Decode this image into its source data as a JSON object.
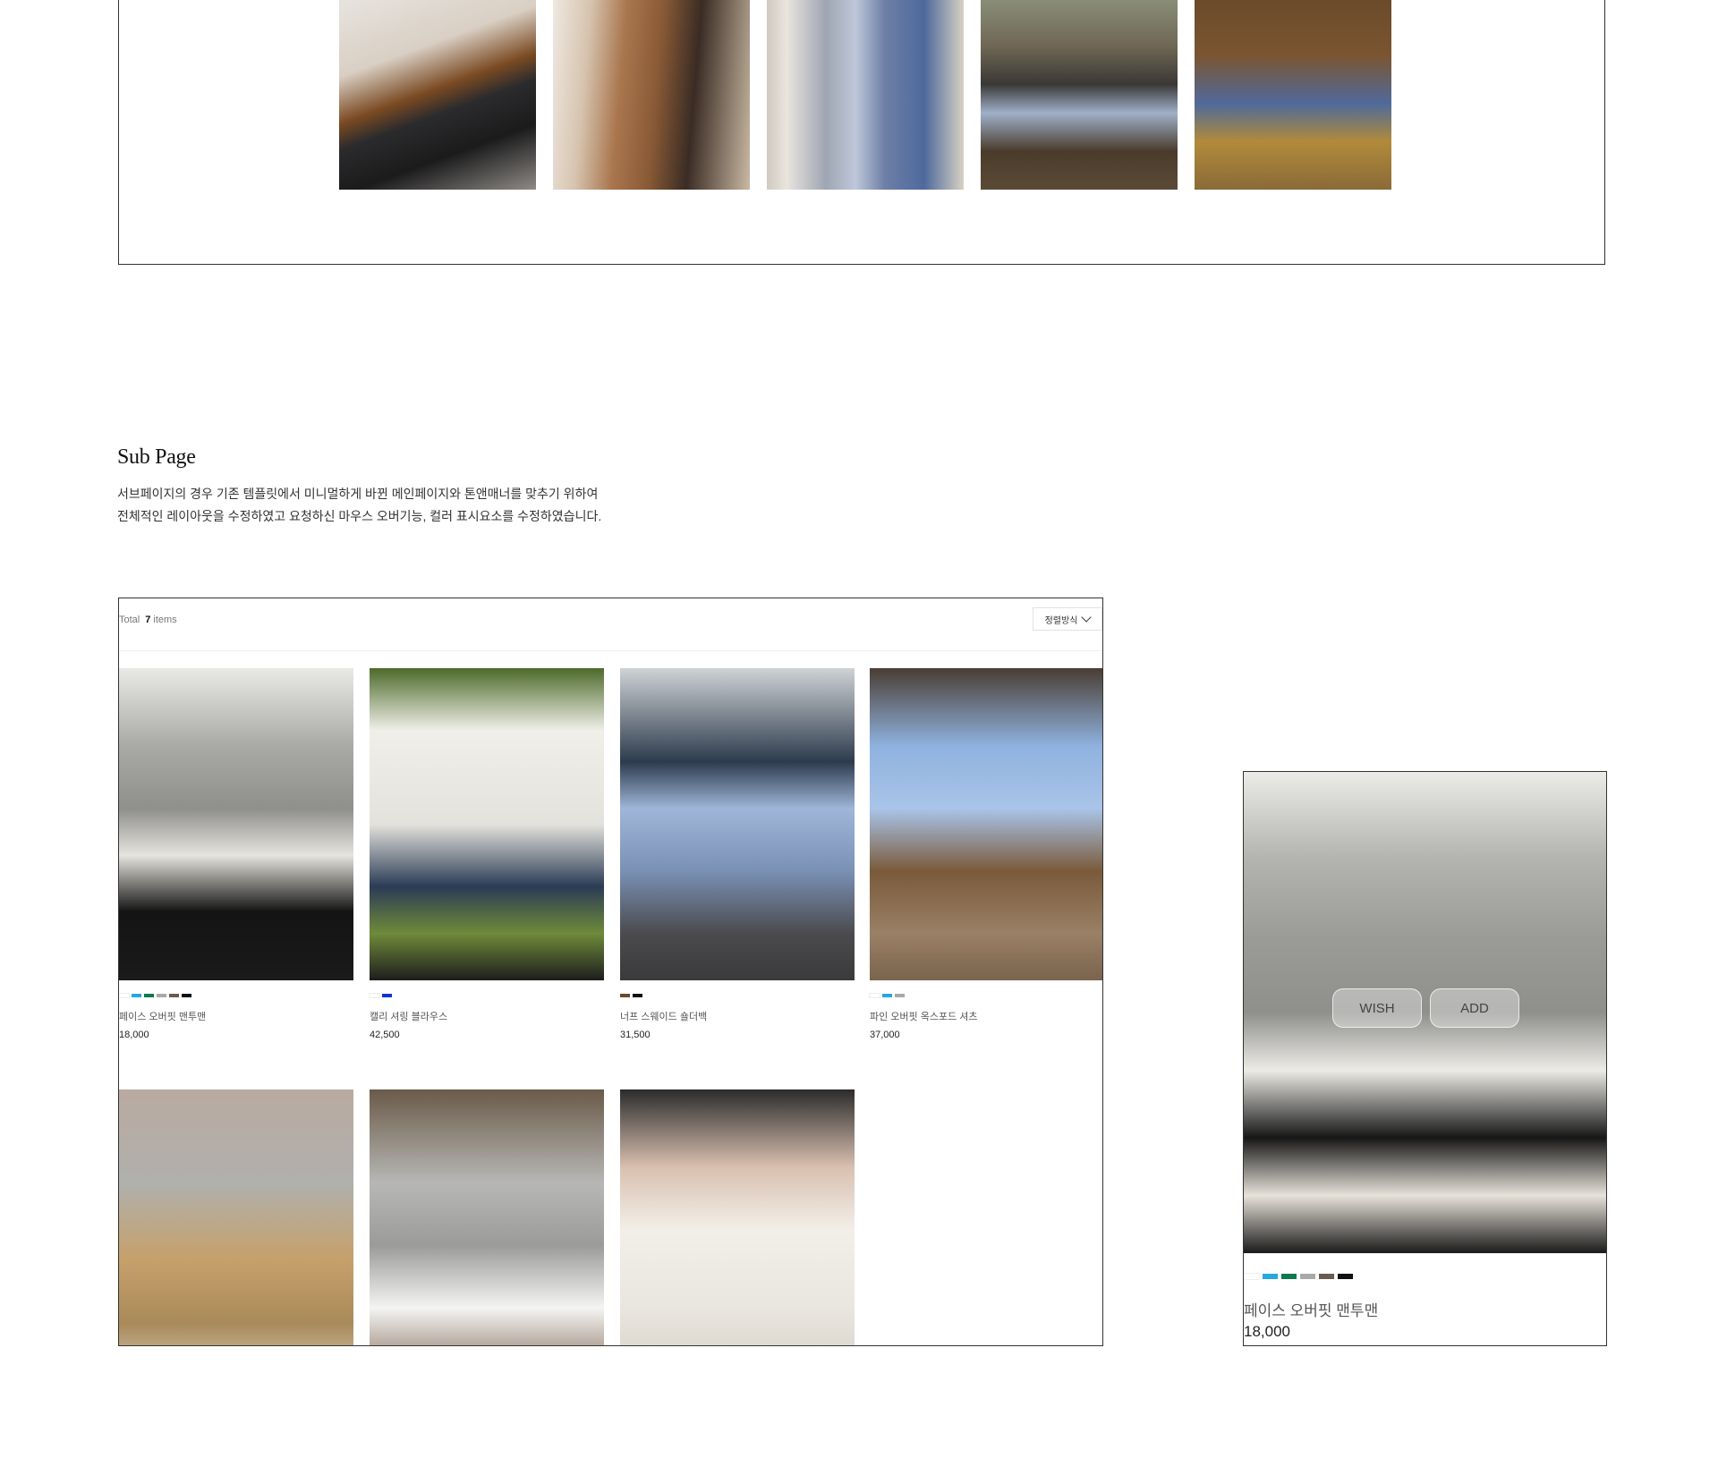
{
  "section": {
    "title": "Sub Page",
    "desc_line1": "서브페이지의 경우 기존 템플릿에서 미니멀하게 바뀐 메인페이지와 톤앤매너를 맞추기 위하여",
    "desc_line2": "전체적인 레이아웃을 수정하였고 요청하신 마우스 오버기능, 컬러 표시요소를 수정하였습니다."
  },
  "list": {
    "total_label": "Total",
    "total_count": "7",
    "items_label": "items",
    "sort_label": "정렬방식"
  },
  "products": [
    {
      "name": "페이스 오버핏 맨투맨",
      "price": "18,000",
      "swatches": [
        "#ffffff",
        "#27a8e0",
        "#0e7a4e",
        "#a9a9a9",
        "#6b5a4e",
        "#111111"
      ]
    },
    {
      "name": "캘리 셔링 블라우스",
      "price": "42,500",
      "swatches": [
        "#ffffff",
        "#1033d6"
      ]
    },
    {
      "name": "너프 스웨이드 숄더백",
      "price": "31,500",
      "swatches": [
        "#6a4a2a",
        "#111111"
      ]
    },
    {
      "name": "파인 오버핏 옥스포드 셔츠",
      "price": "37,000",
      "swatches": [
        "#ffffff",
        "#27a8e0",
        "#a9a9a9"
      ]
    }
  ],
  "hover_card": {
    "wish_label": "WISH",
    "add_label": "ADD",
    "name": "페이스 오버핏 맨투맨",
    "price": "18,000",
    "swatches": [
      "#ffffff",
      "#27a8e0",
      "#0e7a4e",
      "#a9a9a9",
      "#6b5a4e",
      "#111111"
    ]
  }
}
